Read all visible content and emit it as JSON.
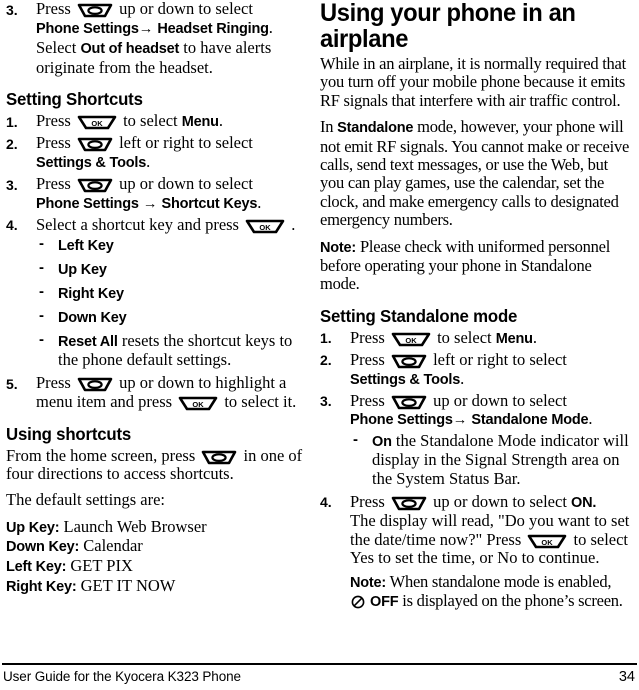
{
  "document": {
    "footer_text": "User Guide for the Kyocera K323 Phone",
    "page_number": "34"
  },
  "icons": {
    "nav_key": "navigation-key-icon",
    "ok_key": "ok-key-icon",
    "ok_label": "OK",
    "standalone_off": "standalone-off-icon",
    "off_label": "OFF",
    "arrow": "→",
    "dash": "-"
  },
  "left_column": {
    "continued_step": {
      "number": "3.",
      "text_before_icon": "Press",
      "text_after_icon": "up or down to select",
      "bold_line_a": "Phone Settings",
      "bold_line_b": "Headset Ringing",
      "period": ".",
      "sub_text_1": "Select ",
      "sub_bold": "Out of headset",
      "sub_text_2": " to have alerts originate from the headset."
    },
    "setting_shortcuts": {
      "heading": "Setting Shortcuts",
      "steps": [
        {
          "number": "1.",
          "pre": "Press",
          "mid": "to select",
          "bold": "Menu",
          "post": "."
        },
        {
          "number": "2.",
          "pre": "Press",
          "mid": "left or right to select",
          "bold": "Settings & Tools",
          "post": "."
        },
        {
          "number": "3.",
          "pre": "Press",
          "mid": "up or down to select",
          "bold_a": "Phone Settings",
          "bold_b": "Shortcut Keys",
          "post": "."
        },
        {
          "number": "4.",
          "pre": "Select a shortcut key and press",
          "post": "."
        }
      ],
      "key_options": [
        {
          "bold": "Left Key",
          "rest": ""
        },
        {
          "bold": "Up Key",
          "rest": ""
        },
        {
          "bold": "Right Key",
          "rest": ""
        },
        {
          "bold": "Down Key",
          "rest": ""
        },
        {
          "bold": "Reset All",
          "rest": " resets the shortcut keys to the phone default settings."
        }
      ],
      "final_step": {
        "number": "5.",
        "pre": "Press",
        "mid": "up or down to highlight a menu item and press",
        "post": "to select it."
      }
    },
    "using_shortcuts": {
      "heading": "Using shortcuts",
      "intro_pre": "From the home screen, press",
      "intro_post": "in one of four directions to access shortcuts.",
      "defaults_lead": "The default settings are:",
      "defaults": [
        {
          "key": "Up Key:",
          "value": "Launch Web Browser"
        },
        {
          "key": "Down Key:",
          "value": "Calendar"
        },
        {
          "key": "Left Key:",
          "value": "GET PIX"
        },
        {
          "key": "Right Key:",
          "value": "GET IT NOW"
        }
      ]
    }
  },
  "right_column": {
    "airplane": {
      "heading": "Using your phone in an airplane",
      "paragraph_1": "While in an airplane, it is normally required that you turn off your mobile phone because it emits RF signals that interfere with air traffic control.",
      "paragraph_2_pre": "In ",
      "paragraph_2_bold": "Standalone",
      "paragraph_2_post": " mode, however, your phone will not emit RF signals. You cannot make or receive calls, send text messages, or use the Web, but you can play games, use the calendar, set the clock, and make emergency calls to designated emergency numbers.",
      "note_label": "Note:",
      "note_text": "Please check with uniformed personnel before operating your phone in Standalone mode."
    },
    "standalone": {
      "heading": "Setting Standalone mode",
      "steps": [
        {
          "number": "1.",
          "pre": "Press",
          "mid": "to select",
          "bold": "Menu",
          "post": "."
        },
        {
          "number": "2.",
          "pre": "Press",
          "mid": "left or right to select",
          "bold": "Settings & Tools",
          "post": "."
        },
        {
          "number": "3.",
          "pre": "Press",
          "mid": "up or down to select",
          "bold_a": "Phone Settings",
          "bold_b": "Standalone Mode",
          "post": "."
        }
      ],
      "sub_bullet": {
        "bold": "On",
        "rest": " the Standalone Mode indicator will display in the Signal Strength area on the System Status Bar."
      },
      "step_4": {
        "number": "4.",
        "pre": "Press",
        "mid": "up or down to select",
        "bold": "ON.",
        "line_2_a": "The display will read, \"Do you want to set the date/time now?\" Press",
        "line_2_b": "to select Yes to set the time, or No to continue."
      },
      "note_label": "Note:",
      "note_text_1": "When standalone mode is enabled,",
      "note_text_2": "is displayed on the phone’s screen."
    }
  }
}
